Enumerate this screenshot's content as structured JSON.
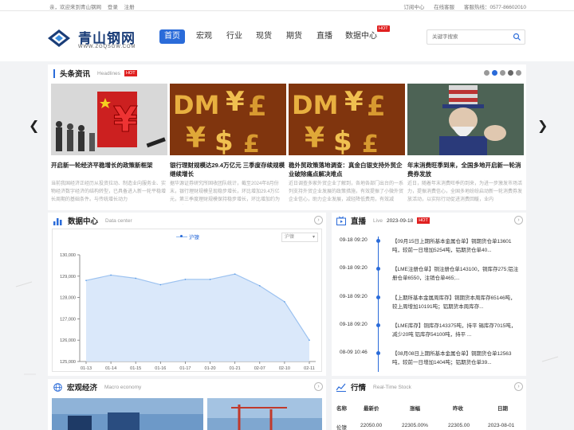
{
  "topbar": {
    "welcome": "亲，欢迎来到青山钢网",
    "login": "登录",
    "register": "注册",
    "subscribe": "订阅中心",
    "service": "在线客服",
    "hotline": "客服热线：0577-86602010"
  },
  "logo": {
    "cn": "青山钢网",
    "en": "WWW.ZGQSGW.COM"
  },
  "nav": [
    {
      "label": "首页"
    },
    {
      "label": "宏观"
    },
    {
      "label": "行业"
    },
    {
      "label": "现货"
    },
    {
      "label": "期货"
    },
    {
      "label": "直播"
    },
    {
      "label": "数据中心"
    }
  ],
  "nav_hot": "HOT",
  "search": {
    "placeholder": "关键字搜索"
  },
  "headlines": {
    "title": "头条资讯",
    "subtitle": "Headlines",
    "hot": "HOT",
    "cards": [
      {
        "title": "开启新一轮经济平稳增长的政策新框架",
        "desc": "当前我国经济正经历从投资拉动、制造业向服务业、实物经济数字经济的结构转型，已具备进入新一轮平稳增长周期的基础条件。与传统增长动力"
      },
      {
        "title": "银行理财规模达29.4万亿元 三季度存续规模继续增长",
        "desc": "据华源证券研究所固收团队统计，截至2024年8月份末，银行理财规模呈现稳步增长，环比增加29.4万亿元，第三季度理财规模保持稳步增长，环比增加约为0.8万亿"
      },
      {
        "title": "稳外贸政策落地调查：真金白银支持外贸企业破除痛点解决难点",
        "desc": "近日调查多家外贸企业了解到，各地各部门出台的一系列支持外贸企业发展的政策措施，有效提振了小微外贸企业信心，助力企业发展，减轻降低费用，有效减"
      },
      {
        "title": "年末消费旺季到来，全国多地开启新一轮消费券发放",
        "desc": "近日，随着年末消费旺季的到来，为进一步激发市场活力，提振消费信心，全国多地纷纷启动新一轮消费券发放活动，以实际行动促进消费回暖，业内"
      }
    ]
  },
  "data_center": {
    "title": "数据中心",
    "subtitle": "Data center",
    "select": "沪镍"
  },
  "chart_data": {
    "type": "line",
    "categories": [
      "01-13",
      "01-14",
      "01-15",
      "01-16",
      "01-17",
      "01-20",
      "01-21",
      "02-07",
      "02-10",
      "02-11"
    ],
    "series": [
      {
        "name": "沪镍",
        "values": [
          128800,
          129050,
          128900,
          128600,
          128850,
          128850,
          129100,
          128550,
          127800,
          126000
        ]
      }
    ],
    "yticks": [
      "125,000",
      "126,000",
      "127,000",
      "128,000",
      "129,000",
      "130,000"
    ],
    "ylim": [
      125000,
      130000
    ],
    "grid": false,
    "legend": "top-center"
  },
  "live": {
    "title": "直播",
    "subtitle": "Live",
    "date": "2023-09-18",
    "hot": "HOT",
    "items": [
      {
        "time": "09-18 09:20",
        "text": "【09月15日上期所基本金属仓单】铜期货仓单13601吨，较前一日增加5254吨，铝期货仓单40..."
      },
      {
        "time": "09-18 09:20",
        "text": "【LME注册仓单】铜注册仓单143100，铜库存275;铝注册仓单6550，注销仓单465;..."
      },
      {
        "time": "09-18 09:20",
        "text": "【上期所基本金属周库存】铜期货本周库存65146吨，较上周增加10191吨；铝期货本周库存..."
      },
      {
        "time": "09-18 09:20",
        "text": "【LME库存】铜库存143375吨，持平 锡库存7015吨，减少20吨 铝库存54100吨，持平 ..."
      },
      {
        "time": "08-09 10:46",
        "text": "【08月08日上期所基本金属仓单】铜期货仓单12563吨，较前一日增加1404吨；铝期货仓单39..."
      }
    ]
  },
  "macro": {
    "title": "宏观经济",
    "subtitle": "Macro economy"
  },
  "quote": {
    "title": "行情",
    "subtitle": "Real-Time Stock",
    "headers": [
      "名称",
      "最新价",
      "涨幅",
      "昨收",
      "日期"
    ],
    "rows": [
      [
        "伦镍",
        "22050.00",
        "22305.00%",
        "22305.00",
        "2023-08-01"
      ]
    ]
  },
  "colors": {
    "accent": "#2a6bd9",
    "hot": "#e02020"
  }
}
